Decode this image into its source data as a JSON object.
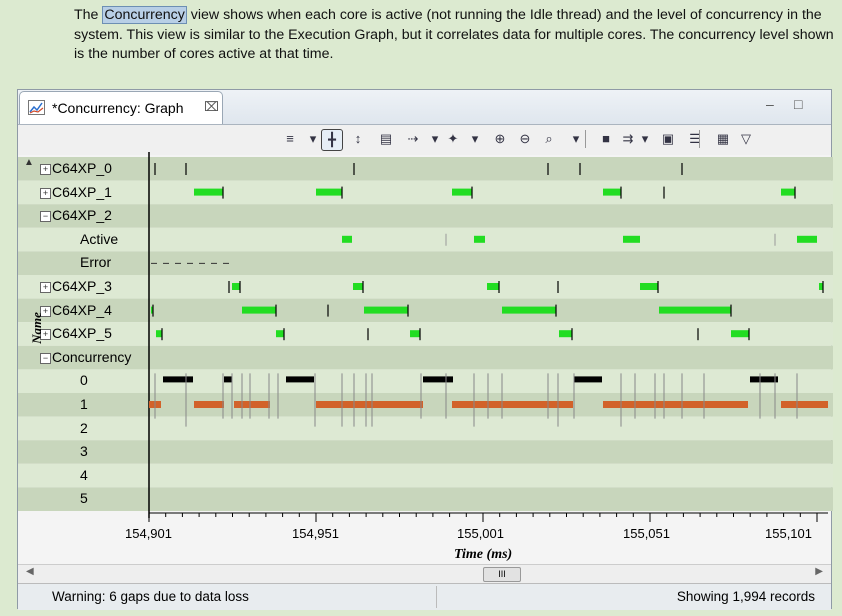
{
  "intro": {
    "before": "The ",
    "highlight": "Concurrency",
    "after": " view shows when each core is active (not running the Idle thread) and the level of concurrency in the system. This view is similar to the Execution Graph, but it correlates data for multiple cores. The concurrency level shown is the number of cores active at that time."
  },
  "tab": {
    "title": "*Concurrency: Graph",
    "close": "⌧"
  },
  "window_buttons": {
    "minimize": "–",
    "maximize": "□"
  },
  "toolbar_icons": [
    "zoom-range-icon",
    "dropdown-icon",
    "align-icon",
    "measure-icon",
    "group-icon",
    "export-icon",
    "dropdown-icon",
    "bookmark-icon",
    "dropdown-icon",
    "zoom-in-icon",
    "zoom-out-icon",
    "zoom-fit-icon",
    "dropdown-icon",
    "find-icon",
    "filter-icon",
    "dropdown-icon",
    "lock-icon",
    "legend-icon",
    "properties-icon",
    "view-menu-icon"
  ],
  "axis_name": "Name",
  "rows": [
    {
      "label": "C64XP_0",
      "type": "expand",
      "indent": false
    },
    {
      "label": "C64XP_1",
      "type": "expand",
      "indent": false
    },
    {
      "label": "C64XP_2",
      "type": "collapse",
      "indent": false
    },
    {
      "label": "Active",
      "type": "none",
      "indent": true
    },
    {
      "label": "Error",
      "type": "none",
      "indent": true
    },
    {
      "label": "C64XP_3",
      "type": "expand",
      "indent": false
    },
    {
      "label": "C64XP_4",
      "type": "expand",
      "indent": false
    },
    {
      "label": "C64XP_5",
      "type": "expand",
      "indent": false
    },
    {
      "label": "Concurrency",
      "type": "collapse",
      "indent": false
    },
    {
      "label": "0",
      "type": "none",
      "indent": true
    },
    {
      "label": "1",
      "type": "none",
      "indent": true
    },
    {
      "label": "2",
      "type": "none",
      "indent": true
    },
    {
      "label": "3",
      "type": "none",
      "indent": true
    },
    {
      "label": "4",
      "type": "none",
      "indent": true
    },
    {
      "label": "5",
      "type": "none",
      "indent": true
    }
  ],
  "x_ticks": [
    "154,901",
    "154,951",
    "155,001",
    "155,051",
    "155,101"
  ],
  "x_label": "Time (ms)",
  "scroll_thumb": "III",
  "status": {
    "left": "Warning: 6 gaps due to data loss",
    "right": "Showing 1,994 records"
  },
  "colors": {
    "active": "#22dd22",
    "concurrency": "#d2622a",
    "level0": "#000000",
    "band_dark": "#c8d6bc",
    "band_light": "#dde9d3"
  }
}
